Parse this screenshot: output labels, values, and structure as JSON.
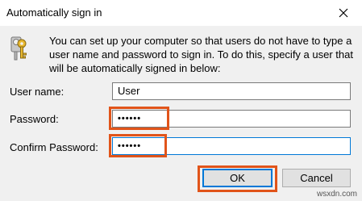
{
  "window": {
    "title": "Automatically sign in"
  },
  "message": "You can set up your computer so that users do not have to type a user name and password to sign in. To do this, specify a user that will be automatically signed in below:",
  "fields": {
    "username": {
      "label": "User name:",
      "value": "User"
    },
    "password": {
      "label": "Password:",
      "value": "••••••"
    },
    "confirm": {
      "label": "Confirm Password:",
      "value": "••••••"
    }
  },
  "buttons": {
    "ok": "OK",
    "cancel": "Cancel"
  },
  "watermark": "wsxdn.com",
  "colors": {
    "highlight": "#e1541a",
    "focus_border": "#0078d7"
  }
}
